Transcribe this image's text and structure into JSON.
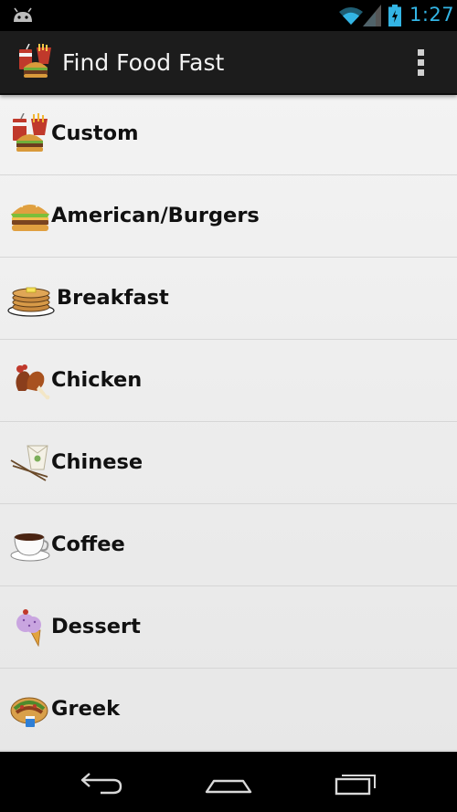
{
  "status_bar": {
    "time": "1:27",
    "icons": [
      "android-icon",
      "wifi-icon",
      "signal-icon",
      "battery-icon"
    ],
    "accent_color": "#33b5e5"
  },
  "action_bar": {
    "title": "Find Food Fast",
    "app_icon": "fast-food-icon",
    "overflow_icon": "overflow-menu-icon"
  },
  "categories": [
    {
      "label": "Custom",
      "icon": "fast-food-combo-icon"
    },
    {
      "label": "American/Burgers",
      "icon": "burger-icon"
    },
    {
      "label": "Breakfast",
      "icon": "pancakes-icon"
    },
    {
      "label": "Chicken",
      "icon": "chicken-icon"
    },
    {
      "label": "Chinese",
      "icon": "takeout-box-icon"
    },
    {
      "label": "Coffee",
      "icon": "coffee-cup-icon"
    },
    {
      "label": "Dessert",
      "icon": "ice-cream-icon"
    },
    {
      "label": "Greek",
      "icon": "gyro-icon"
    }
  ],
  "nav_bar": {
    "icons": [
      "back-icon",
      "home-icon",
      "recent-apps-icon"
    ]
  }
}
